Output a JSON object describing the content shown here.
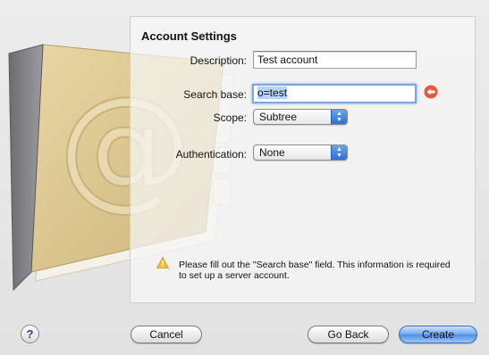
{
  "section_title": "Account Settings",
  "form": {
    "description_label": "Description:",
    "description_value": "Test account",
    "search_base_label": "Search base:",
    "search_base_value": "o=test",
    "scope_label": "Scope:",
    "scope_value": "Subtree",
    "authentication_label": "Authentication:",
    "authentication_value": "None"
  },
  "warning": {
    "icon": "warning-icon",
    "text": "Please fill out the \"Search base\" field. This information is required to set up a server account."
  },
  "buttons": {
    "help": "?",
    "cancel": "Cancel",
    "go_back": "Go Back",
    "create": "Create"
  },
  "colors": {
    "focus_ring": "#7ba7e1",
    "default_button": "#4b8ee6",
    "error_icon": "#e8553b",
    "warning_icon": "#f2c230"
  }
}
